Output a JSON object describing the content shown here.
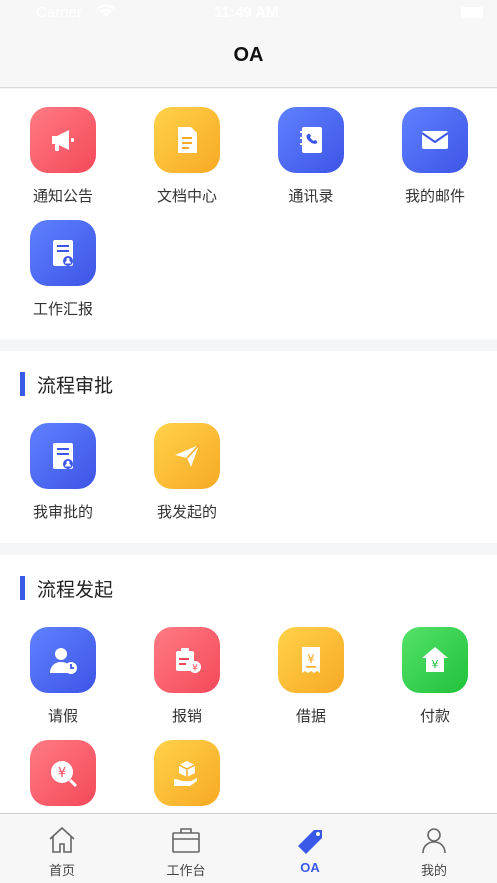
{
  "status_bar": {
    "carrier": "Carrier",
    "time": "11:49 AM"
  },
  "nav": {
    "title": "OA"
  },
  "section_office": {
    "items": [
      {
        "label": "通知公告",
        "icon": "megaphone-icon"
      },
      {
        "label": "文档中心",
        "icon": "document-icon"
      },
      {
        "label": "通讯录",
        "icon": "contact-book-icon"
      },
      {
        "label": "我的邮件",
        "icon": "mail-icon"
      },
      {
        "label": "工作汇报",
        "icon": "report-icon"
      }
    ]
  },
  "section_approval": {
    "title": "流程审批",
    "items": [
      {
        "label": "我审批的",
        "icon": "approval-icon"
      },
      {
        "label": "我发起的",
        "icon": "paper-plane-icon"
      }
    ]
  },
  "section_initiate": {
    "title": "流程发起",
    "items": [
      {
        "label": "请假",
        "icon": "leave-icon"
      },
      {
        "label": "报销",
        "icon": "reimburse-icon"
      },
      {
        "label": "借据",
        "icon": "receipt-icon"
      },
      {
        "label": "付款",
        "icon": "payment-icon"
      },
      {
        "label": "",
        "icon": "yen-coin-icon"
      },
      {
        "label": "",
        "icon": "package-hand-icon"
      }
    ]
  },
  "tabbar": {
    "tabs": [
      {
        "label": "首页",
        "icon": "home-icon"
      },
      {
        "label": "工作台",
        "icon": "briefcase-icon"
      },
      {
        "label": "OA",
        "icon": "tag-icon",
        "active": true
      },
      {
        "label": "我的",
        "icon": "user-icon"
      }
    ]
  },
  "colors": {
    "accent": "#3a59e7",
    "red": "#f4495a",
    "yellow": "#f8a924",
    "blue": "#3d55e6",
    "green": "#20c13a"
  }
}
